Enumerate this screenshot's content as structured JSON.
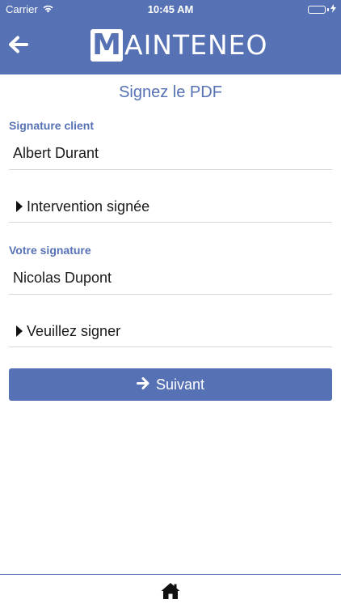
{
  "status_bar": {
    "carrier": "Carrier",
    "time": "10:45 AM"
  },
  "header": {
    "logo_letter": "M",
    "logo_rest": "AINTENEO"
  },
  "page": {
    "title": "Signez le PDF"
  },
  "client_section": {
    "label": "Signature client",
    "name_value": "Albert Durant",
    "signature_row": "Intervention signée"
  },
  "own_section": {
    "label": "Votre signature",
    "name_value": "Nicolas Dupont",
    "signature_row": "Veuillez signer"
  },
  "actions": {
    "next_label": "Suivant"
  },
  "icons": {
    "back": "arrow-left-icon",
    "next": "arrow-right-icon",
    "caret": "caret-right-icon",
    "home": "home-icon",
    "wifi": "wifi-icon",
    "battery": "battery-icon",
    "charging": "bolt-icon"
  },
  "colors": {
    "brand": "#5672b4",
    "divider": "#d6d6d6",
    "battery": "#4cd964"
  }
}
